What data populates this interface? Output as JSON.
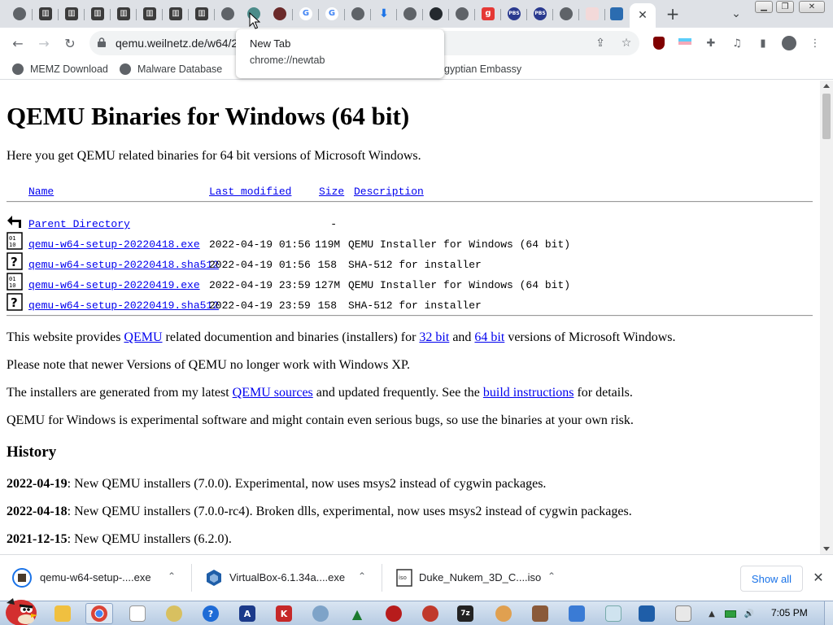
{
  "browser": {
    "tooltip": {
      "title": "New Tab",
      "url": "chrome://newtab"
    },
    "address_bar": {
      "url": "qemu.weilnetz.de/w64/2"
    },
    "bookmarks": [
      {
        "label": "MEMZ Download"
      },
      {
        "label": "Malware Database"
      },
      {
        "label": "gyptian Embassy"
      }
    ]
  },
  "page": {
    "title": "QEMU Binaries for Windows (64 bit)",
    "intro": "Here you get QEMU related binaries for 64 bit versions of Microsoft Windows.",
    "columns": {
      "name": "Name",
      "modified": "Last modified",
      "size": "Size",
      "description": "Description"
    },
    "parent": {
      "name": "Parent Directory",
      "size": "-"
    },
    "files": [
      {
        "name": "qemu-w64-setup-20220418.exe",
        "modified": "2022-04-19 01:56",
        "size": "119M",
        "description": "QEMU Installer for Windows (64 bit)",
        "type": "exe"
      },
      {
        "name": "qemu-w64-setup-20220418.sha512",
        "modified": "2022-04-19 01:56",
        "size": "158",
        "description": "SHA-512 for installer",
        "type": "unknown"
      },
      {
        "name": "qemu-w64-setup-20220419.exe",
        "modified": "2022-04-19 23:59",
        "size": "127M",
        "description": "QEMU Installer for Windows (64 bit)",
        "type": "exe"
      },
      {
        "name": "qemu-w64-setup-20220419.sha512",
        "modified": "2022-04-19 23:59",
        "size": "158",
        "description": "SHA-512 for installer",
        "type": "unknown"
      }
    ],
    "para1": {
      "t1": "This website provides ",
      "l1": "QEMU",
      "t2": " related documention and binaries (installers) for ",
      "l2": "32 bit",
      "t3": " and ",
      "l3": "64 bit",
      "t4": " versions of Microsoft Windows."
    },
    "para2": "Please note that newer Versions of QEMU no longer work with Windows XP.",
    "para3": {
      "t1": "The installers are generated from my latest ",
      "l1": "QEMU sources",
      "t2": " and updated frequently. See the ",
      "l2": "build instructions",
      "t3": " for details."
    },
    "para4": "QEMU for Windows is experimental software and might contain even serious bugs, so use the binaries at your own risk.",
    "history_heading": "History",
    "history": [
      {
        "date": "2022-04-19",
        "text": ": New QEMU installers (7.0.0). Experimental, now uses msys2 instead of cygwin packages."
      },
      {
        "date": "2022-04-18",
        "text": ": New QEMU installers (7.0.0-rc4). Broken dlls, experimental, now uses msys2 instead of cygwin packages."
      },
      {
        "date": "2021-12-15",
        "text": ": New QEMU installers (6.2.0)."
      }
    ]
  },
  "downloads": {
    "items": [
      {
        "name": "qemu-w64-setup-....exe"
      },
      {
        "name": "VirtualBox-6.1.34a....exe"
      },
      {
        "name": "Duke_Nukem_3D_C....iso"
      }
    ],
    "show_all": "Show all"
  },
  "taskbar": {
    "clock": "7:05 PM"
  },
  "colors": {
    "link": "#0000ee",
    "tabstrip": "#dee1e6",
    "accent": "#1a73e8"
  }
}
